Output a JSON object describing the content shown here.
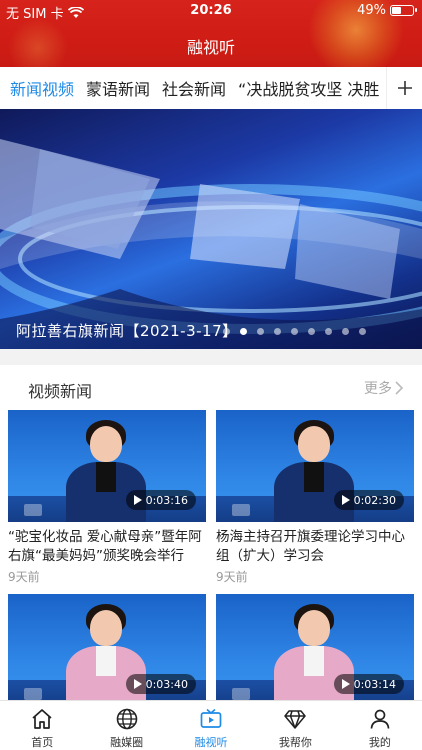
{
  "status": {
    "carrier": "无 SIM 卡",
    "time": "20:26",
    "battery": "49%",
    "battery_level": 0.49
  },
  "header": {
    "title": "融视听"
  },
  "tabs": [
    {
      "label": "新闻视频",
      "active": true
    },
    {
      "label": "蒙语新闻",
      "active": false
    },
    {
      "label": "社会新闻",
      "active": false
    },
    {
      "label": "“决战脱贫攻坚 决胜",
      "active": false
    }
  ],
  "banner": {
    "caption": "阿拉善右旗新闻【2021-3-17】",
    "page_count": 9,
    "current_page": 1
  },
  "section": {
    "title": "视频新闻",
    "more": "更多"
  },
  "videos": [
    {
      "title": "“驼宝化妆品 爱心献母亲”暨年阿右旗“最美妈妈”颁奖晚会举行",
      "time": "9天前",
      "duration": "0:03:16",
      "outfit": "navy"
    },
    {
      "title": "杨海主持召开旗委理论学习中心组（扩大）学习会",
      "time": "9天前",
      "duration": "0:02:30",
      "outfit": "navy"
    },
    {
      "title": "",
      "time": "",
      "duration": "0:03:40",
      "outfit": "pink"
    },
    {
      "title": "",
      "time": "",
      "duration": "0:03:14",
      "outfit": "pink"
    }
  ],
  "nav": [
    {
      "label": "首页",
      "icon": "home-icon",
      "active": false
    },
    {
      "label": "融媒圈",
      "icon": "globe-icon",
      "active": false
    },
    {
      "label": "融视听",
      "icon": "tv-icon",
      "active": true
    },
    {
      "label": "我帮你",
      "icon": "diamond-icon",
      "active": false
    },
    {
      "label": "我的",
      "icon": "person-icon",
      "active": false
    }
  ],
  "colors": {
    "header_red": "#d6231b",
    "accent_blue": "#1f8be6"
  }
}
